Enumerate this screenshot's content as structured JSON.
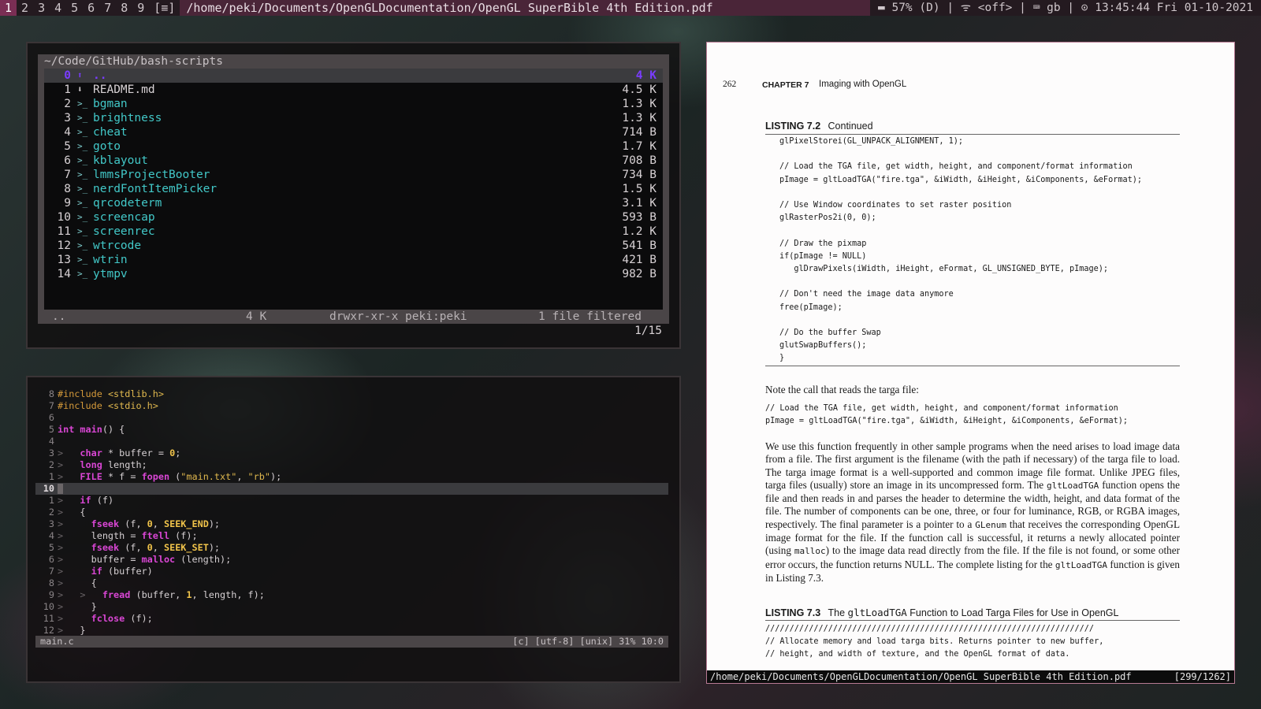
{
  "topbar": {
    "workspaces": [
      "1",
      "2",
      "3",
      "4",
      "5",
      "6",
      "7",
      "8",
      "9"
    ],
    "active_workspace": "1",
    "layout_indicator": "[≡]",
    "window_title": "/home/peki/Documents/OpenGLDocumentation/OpenGL SuperBible 4th Edition.pdf",
    "battery": "▬ 57% (D)",
    "wifi": "ᯤ <off>",
    "keyboard": "⌨ gb",
    "clock": "⊙ 13:45:44 Fri 01-10-2021",
    "separator": "|"
  },
  "file_manager": {
    "path": "~/Code/GitHub/bash-scripts",
    "parent": {
      "num": "0",
      "icon": "⬆",
      "name": "..",
      "size": "4 K"
    },
    "files": [
      {
        "num": "1",
        "icon": "⬇",
        "name": "README.md",
        "size": "4.5 K",
        "kind": "file"
      },
      {
        "num": "2",
        "icon": ">_",
        "name": "bgman",
        "size": "1.3 K",
        "kind": "exec"
      },
      {
        "num": "3",
        "icon": ">_",
        "name": "brightness",
        "size": "1.3 K",
        "kind": "exec"
      },
      {
        "num": "4",
        "icon": ">_",
        "name": "cheat",
        "size": "714 B",
        "kind": "exec"
      },
      {
        "num": "5",
        "icon": ">_",
        "name": "goto",
        "size": "1.7 K",
        "kind": "exec"
      },
      {
        "num": "6",
        "icon": ">_",
        "name": "kblayout",
        "size": "708 B",
        "kind": "exec"
      },
      {
        "num": "7",
        "icon": ">_",
        "name": "lmmsProjectBooter",
        "size": "734 B",
        "kind": "exec"
      },
      {
        "num": "8",
        "icon": ">_",
        "name": "nerdFontItemPicker",
        "size": "1.5 K",
        "kind": "exec"
      },
      {
        "num": "9",
        "icon": ">_",
        "name": "qrcodeterm",
        "size": "3.1 K",
        "kind": "exec"
      },
      {
        "num": "10",
        "icon": ">_",
        "name": "screencap",
        "size": "593 B",
        "kind": "exec"
      },
      {
        "num": "11",
        "icon": ">_",
        "name": "screenrec",
        "size": "1.2 K",
        "kind": "exec"
      },
      {
        "num": "12",
        "icon": ">_",
        "name": "wtrcode",
        "size": "541 B",
        "kind": "exec"
      },
      {
        "num": "13",
        "icon": ">_",
        "name": "wtrin",
        "size": "421 B",
        "kind": "exec"
      },
      {
        "num": "14",
        "icon": ">_",
        "name": "ytmpv",
        "size": "982 B",
        "kind": "exec"
      }
    ],
    "status": {
      "name": "..",
      "size": "4 K",
      "perms": "drwxr-xr-x peki:peki",
      "filter": "1 file filtered"
    },
    "count": "1/15"
  },
  "editor": {
    "lines": [
      {
        "ln": "8",
        "html": "<span class=\"pp\">#include</span> <span class=\"str\">&lt;stdlib.h&gt;</span>"
      },
      {
        "ln": "7",
        "html": "<span class=\"pp\">#include</span> <span class=\"str\">&lt;stdio.h&gt;</span>"
      },
      {
        "ln": "6",
        "html": ""
      },
      {
        "ln": "5",
        "html": "<span class=\"ty\">int</span> <span class=\"fn\">main</span>() {"
      },
      {
        "ln": "4",
        "html": ""
      },
      {
        "ln": "3",
        "html": "<span class=\"ind\">&gt;</span>   <span class=\"ty\">char</span> * buffer = <span class=\"num2\">0</span>;"
      },
      {
        "ln": "2",
        "html": "<span class=\"ind\">&gt;</span>   <span class=\"ty\">long</span> length;"
      },
      {
        "ln": "1",
        "html": "<span class=\"ind\">&gt;</span>   <span class=\"ty\">FILE</span> * f = <span class=\"fn\">fopen</span> (<span class=\"str\">\"main.txt\"</span>, <span class=\"str\">\"rb\"</span>);"
      },
      {
        "ln": "10",
        "html": "<span class=\"cursor\"></span>",
        "current": true
      },
      {
        "ln": "1",
        "html": "<span class=\"ind\">&gt;</span>   <span class=\"kw\">if</span> (f)"
      },
      {
        "ln": "2",
        "html": "<span class=\"ind\">&gt;</span>   {"
      },
      {
        "ln": "3",
        "html": "<span class=\"ind\">&gt;</span>     <span class=\"fn\">fseek</span> (f, <span class=\"num2\">0</span>, <span class=\"mac\">SEEK_END</span>);"
      },
      {
        "ln": "4",
        "html": "<span class=\"ind\">&gt;</span>     length = <span class=\"fn\">ftell</span> (f);"
      },
      {
        "ln": "5",
        "html": "<span class=\"ind\">&gt;</span>     <span class=\"fn\">fseek</span> (f, <span class=\"num2\">0</span>, <span class=\"mac\">SEEK_SET</span>);"
      },
      {
        "ln": "6",
        "html": "<span class=\"ind\">&gt;</span>     buffer = <span class=\"fn\">malloc</span> (length);"
      },
      {
        "ln": "7",
        "html": "<span class=\"ind\">&gt;</span>     <span class=\"kw\">if</span> (buffer)"
      },
      {
        "ln": "8",
        "html": "<span class=\"ind\">&gt;</span>     {"
      },
      {
        "ln": "9",
        "html": "<span class=\"ind\">&gt;</span>   <span class=\"ind\">&gt;</span>   <span class=\"fn\">fread</span> (buffer, <span class=\"num2\">1</span>, length, f);"
      },
      {
        "ln": "10",
        "html": "<span class=\"ind\">&gt;</span>     }"
      },
      {
        "ln": "11",
        "html": "<span class=\"ind\">&gt;</span>     <span class=\"fn\">fclose</span> (f);"
      },
      {
        "ln": "12",
        "html": "<span class=\"ind\">&gt;</span>   }"
      }
    ],
    "status": {
      "filename": "main.c",
      "info": "[c] [utf-8] [unix] 31% 10:0"
    }
  },
  "pdf": {
    "page_number": "262",
    "chapter_label": "CHAPTER 7",
    "chapter_title": "Imaging with OpenGL",
    "listing1_label": "LISTING 7.2",
    "listing1_title": "Continued",
    "listing1_code": "glPixelStorei(GL_UNPACK_ALIGNMENT, 1);\n\n// Load the TGA file, get width, height, and component/format information\npImage = gltLoadTGA(\"fire.tga\", &iWidth, &iHeight, &iComponents, &eFormat);\n\n// Use Window coordinates to set raster position\nglRasterPos2i(0, 0);\n\n// Draw the pixmap\nif(pImage != NULL)\n   glDrawPixels(iWidth, iHeight, eFormat, GL_UNSIGNED_BYTE, pImage);\n\n// Don't need the image data anymore\nfree(pImage);\n\n// Do the buffer Swap\nglutSwapBuffers();\n}",
    "note_line": "Note the call that reads the targa file:",
    "note_code": "// Load the TGA file, get width, height, and component/format information\npImage = gltLoadTGA(\"fire.tga\", &iWidth, &iHeight, &iComponents, &eFormat);",
    "paragraph_html": "We use this function frequently in other sample programs when the need arises to load image data from a file. The first argument is the filename (with the path if necessary) of the targa file to load. The targa image format is a well-supported and common image file format. Unlike JPEG files, targa files (usually) store an image in its uncompressed form. The <code>gltLoadTGA</code> function opens the file and then reads in and parses the header to determine the width, height, and data format of the file. The number of components can be one, three, or four for luminance, RGB, or RGBA images, respectively. The final parameter is a pointer to a <code>GLenum</code> that receives the corresponding OpenGL image format for the file. If the function call is successful, it returns a newly allocated pointer (using <code>malloc</code>) to the image data read directly from the file. If the file is not found, or some other error occurs, the function returns NULL. The complete listing for the <code>gltLoadTGA</code> function is given in Listing 7.3.",
    "listing2_label": "LISTING 7.3",
    "listing2_title_html": "The <code>gltLoadTGA</code> Function to Load Targa Files for Use in OpenGL",
    "listing2_code": "////////////////////////////////////////////////////////////////////\n// Allocate memory and load targa bits. Returns pointer to new buffer,\n// height, and width of texture, and the OpenGL format of data.",
    "status_path": "/home/peki/Documents/OpenGLDocumentation/OpenGL SuperBible 4th Edition.pdf",
    "status_page": "[299/1262]"
  }
}
